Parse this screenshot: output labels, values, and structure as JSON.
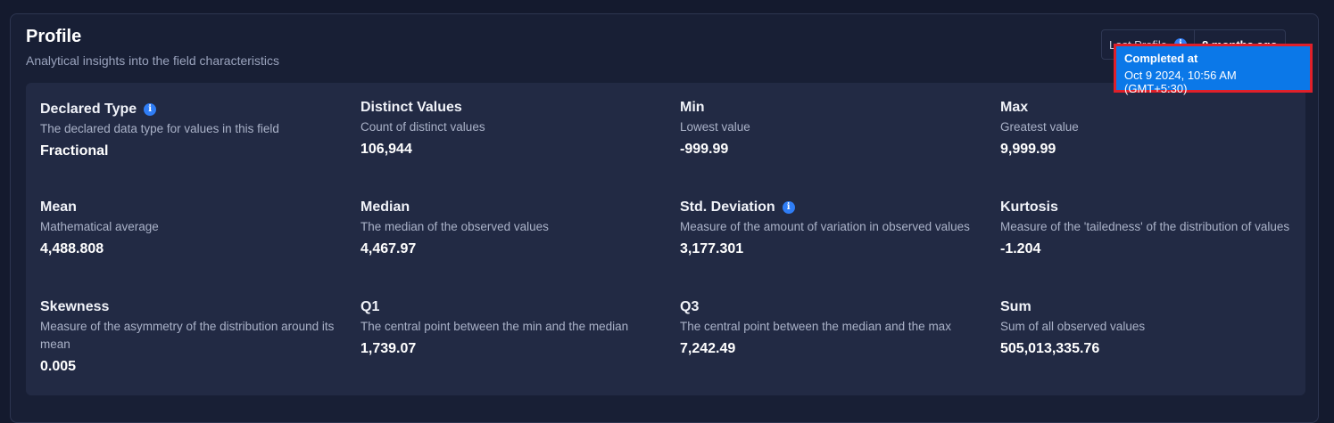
{
  "header": {
    "title": "Profile",
    "subtitle": "Analytical insights into the field characteristics",
    "last_profile_label": "Last Profile",
    "last_profile_value": "8 months ago"
  },
  "tooltip": {
    "title": "Completed at",
    "value": "Oct 9 2024, 10:56 AM (GMT+5:30)"
  },
  "metrics": [
    {
      "name": "Declared Type",
      "description": "The declared data type for values in this field",
      "value": "Fractional",
      "info": true
    },
    {
      "name": "Distinct Values",
      "description": "Count of distinct values",
      "value": "106,944"
    },
    {
      "name": "Min",
      "description": "Lowest value",
      "value": "-999.99"
    },
    {
      "name": "Max",
      "description": "Greatest value",
      "value": "9,999.99"
    },
    {
      "name": "Mean",
      "description": "Mathematical average",
      "value": "4,488.808"
    },
    {
      "name": "Median",
      "description": "The median of the observed values",
      "value": "4,467.97"
    },
    {
      "name": "Std. Deviation",
      "description": "Measure of the amount of variation in observed values",
      "value": "3,177.301",
      "info": true
    },
    {
      "name": "Kurtosis",
      "description": "Measure of the 'tailedness' of the distribution of values",
      "value": "-1.204"
    },
    {
      "name": "Skewness",
      "description": "Measure of the asymmetry of the distribution around its mean",
      "value": "0.005"
    },
    {
      "name": "Q1",
      "description": "The central point between the min and the median",
      "value": "1,739.07"
    },
    {
      "name": "Q3",
      "description": "The central point between the median and the max",
      "value": "7,242.49"
    },
    {
      "name": "Sum",
      "description": "Sum of all observed values",
      "value": "505,013,335.76"
    }
  ],
  "colors": {
    "background": "#141a2e",
    "panel": "#222a44",
    "accent": "#2f7df6",
    "tooltip_bg": "#0b78e8",
    "tooltip_border": "#e0202a"
  },
  "icons": {
    "info": "i"
  }
}
